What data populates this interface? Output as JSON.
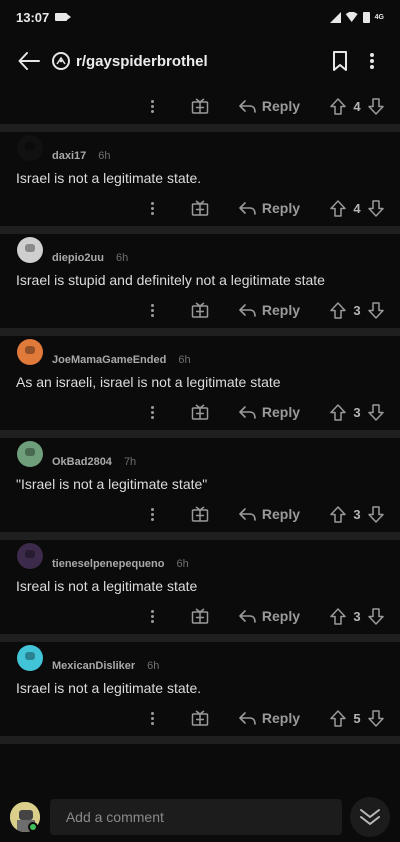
{
  "status": {
    "time": "13:07",
    "network": "4G"
  },
  "header": {
    "subreddit": "r/gayspiderbrothel"
  },
  "top_actions": {
    "reply_label": "Reply",
    "votes": "4"
  },
  "comments": [
    {
      "username": "daxi17",
      "age": "6h",
      "text": "Israel is not a legitimate state.",
      "reply_label": "Reply",
      "votes": "4",
      "avatar_color": "#111111"
    },
    {
      "username": "diepio2uu",
      "age": "6h",
      "text": "Israel is stupid and definitely not a legitimate state",
      "reply_label": "Reply",
      "votes": "3",
      "avatar_color": "#cfcfcf"
    },
    {
      "username": "JoeMamaGameEnded",
      "age": "6h",
      "text": "As an israeli, israel is not a legitimate state",
      "reply_label": "Reply",
      "votes": "3",
      "avatar_color": "#e07a3b"
    },
    {
      "username": "OkBad2804",
      "age": "7h",
      "text": "\"Israel is not a legitimate state\"",
      "reply_label": "Reply",
      "votes": "3",
      "avatar_color": "#6e9e7a"
    },
    {
      "username": "tieneselpenepequeno",
      "age": "6h",
      "text": "Isreal is not a legitimate state",
      "reply_label": "Reply",
      "votes": "3",
      "avatar_color": "#3b2a4a"
    },
    {
      "username": "MexicanDisliker",
      "age": "6h",
      "text": "Israel is not a legitimate state.",
      "reply_label": "Reply",
      "votes": "5",
      "avatar_color": "#41c4d8"
    }
  ],
  "composer": {
    "placeholder": "Add a comment"
  }
}
